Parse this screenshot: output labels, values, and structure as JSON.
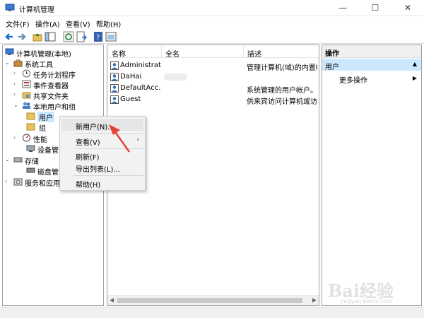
{
  "window": {
    "title": "计算机管理",
    "controls": {
      "minimize": "—",
      "maximize": "☐",
      "close": "✕"
    }
  },
  "menubar": [
    "文件(F)",
    "操作(A)",
    "查看(V)",
    "帮助(H)"
  ],
  "toolbar": {
    "icons": [
      "back-arrow-icon",
      "forward-arrow-icon",
      "up-folder-icon",
      "show-hide-tree-icon",
      "refresh-icon",
      "export-list-icon",
      "help-icon",
      "properties-icon"
    ]
  },
  "tree": {
    "root": "计算机管理(本地)",
    "system_tools": "系统工具",
    "task_scheduler": "任务计划程序",
    "event_viewer": "事件查看器",
    "shared_folders": "共享文件夹",
    "local_users_groups": "本地用户和组",
    "users": "用户",
    "groups": "组",
    "performance": "性能",
    "device_manager": "设备管",
    "storage": "存储",
    "disk_management": "磁盘管",
    "services_apps": "服务和应用"
  },
  "list": {
    "columns": [
      "名称",
      "全名",
      "描述"
    ],
    "rows": [
      {
        "name": "Administrat...",
        "fullname": "",
        "description": "管理计算机(域)的内置帐户"
      },
      {
        "name": "DaHai",
        "fullname": "",
        "description": ""
      },
      {
        "name": "DefaultAcc...",
        "fullname": "",
        "description": "系统管理的用户帐户。"
      },
      {
        "name": "Guest",
        "fullname": "",
        "description": "供来宾访问计算机或访问"
      }
    ]
  },
  "actions": {
    "header": "操作",
    "section": "用户",
    "more": "更多操作"
  },
  "context_menu": {
    "new_user": "新用户(N)...",
    "view": "查看(V)",
    "refresh": "刷新(F)",
    "export_list": "导出列表(L)...",
    "help": "帮助(H)"
  },
  "watermark": {
    "logo": "Bai经验",
    "url": "jingyan.baidu.com"
  },
  "colors": {
    "selection": "#cce8ff",
    "annotation_arrow": "#e8403a"
  }
}
